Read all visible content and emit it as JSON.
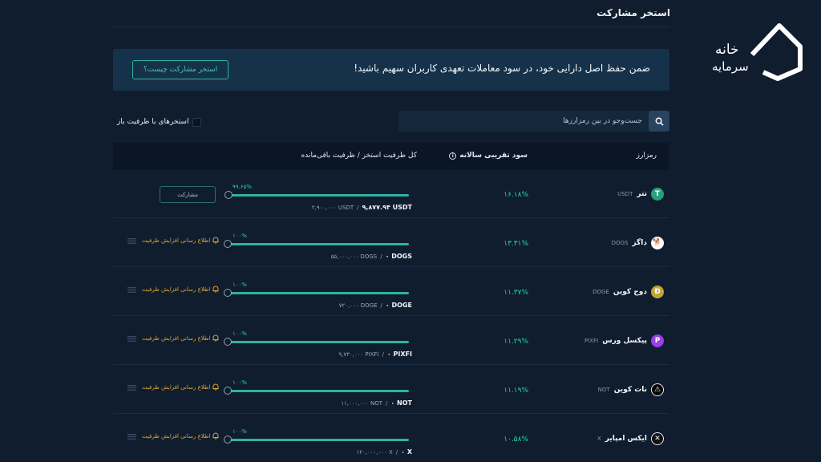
{
  "page": {
    "title": "استخر مشارکت"
  },
  "logo": {
    "line1": "خانه",
    "line2": "سرمایه"
  },
  "banner": {
    "text": "ضمن حفظ اصل دارایی خود، در سود معاملات تعهدی کاربران سهیم باشید!",
    "button_label": "استخر مشارکت چیست؟"
  },
  "search": {
    "placeholder": "جست‌وجو در بین رمزارزها"
  },
  "filter": {
    "label": "استخرهای با ظرفیت باز"
  },
  "table": {
    "headers": {
      "coin": "رمزارز",
      "apy": "سود تقریبی سالانه",
      "capacity": "کل ظرفیت استخر / ظرفیت باقی‌مانده"
    },
    "participate_label": "مشارکت",
    "notify_label": "اطلاع رسانی افزایش ظرفیت",
    "rows": [
      {
        "name": "تتر",
        "symbol": "USDT",
        "apy": "۱۶.۱۸%",
        "pct": "۹۹.۶۵%",
        "total": "۲,۹۰۰,۰۰۰ USDT",
        "remaining": "۹,۸۷۷.۹۴ USDT",
        "fill": 0.9965,
        "action": "participate",
        "icon_color": "#26a17b",
        "icon_glyph": "T"
      },
      {
        "name": "داگز",
        "symbol": "DOGS",
        "apy": "۱۳.۳۱%",
        "pct": "۱۰۰%",
        "total": "۵۵,۰۰۰,۰۰۰ DOGS",
        "remaining": "۰ DOGS",
        "fill": 1.0,
        "action": "notify",
        "icon_color": "#ffffff",
        "icon_glyph": "🐕"
      },
      {
        "name": "دوج کوین",
        "symbol": "DOGE",
        "apy": "۱۱.۳۷%",
        "pct": "۱۰۰%",
        "total": "۷۲۰,۰۰۰ DOGE",
        "remaining": "۰ DOGE",
        "fill": 1.0,
        "action": "notify",
        "icon_color": "#c2a633",
        "icon_glyph": "Ð"
      },
      {
        "name": "پیکسل ورس",
        "symbol": "PIXFI",
        "apy": "۱۱.۲۹%",
        "pct": "۱۰۰%",
        "total": "۹,۷۳۰,۰۰۰ PIXFI",
        "remaining": "۰ PIXFI",
        "fill": 1.0,
        "action": "notify",
        "icon_color": "#9b3de8",
        "icon_glyph": "P"
      },
      {
        "name": "نات کوین",
        "symbol": "NOT",
        "apy": "۱۱.۱۹%",
        "pct": "۱۰۰%",
        "total": "۱۱,۰۰۰,۰۰۰ NOT",
        "remaining": "۰ NOT",
        "fill": 1.0,
        "action": "notify",
        "icon_color": "#000000",
        "icon_glyph": "⚠"
      },
      {
        "name": "ایکس امپایر",
        "symbol": "X",
        "apy": "۱۰.۵۸%",
        "pct": "۱۰۰%",
        "total": "۱۲۰,۰۰۰,۰۰۰ X",
        "remaining": "۰ X",
        "fill": 1.0,
        "action": "notify",
        "icon_color": "#101010",
        "icon_glyph": "✕"
      }
    ]
  },
  "colors": {
    "background": "#0f1d2e",
    "accent": "#2fd0a8",
    "warning": "#e4a432"
  }
}
